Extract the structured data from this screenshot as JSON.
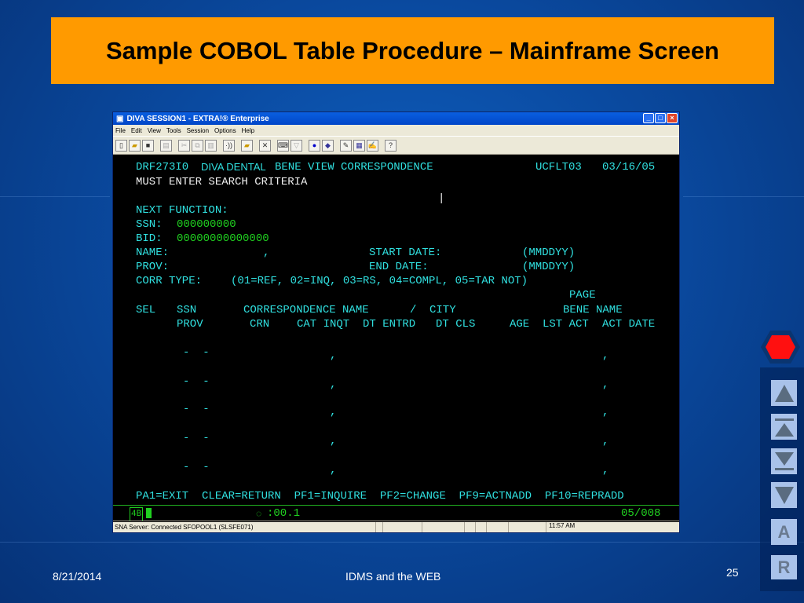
{
  "slide": {
    "title": "Sample COBOL Table Procedure – Mainframe Screen",
    "date": "8/21/2014",
    "footer": "IDMS and the WEB",
    "page": "25"
  },
  "window": {
    "title": "DIVA SESSION1 - EXTRA!® Enterprise",
    "menu": [
      "File",
      "Edit",
      "View",
      "Tools",
      "Session",
      "Options",
      "Help"
    ],
    "status": "SNA Server: Connected SFOPOOL1 (SLSFE071)",
    "clock": "11:57 AM"
  },
  "terminal": {
    "program": "DRF273I0",
    "system": "DIVA DENTAL",
    "screen_title": "BENE VIEW CORRESPONDENCE",
    "user": "UCFLT03",
    "date": "03/16/05",
    "message": "MUST ENTER SEARCH CRITERIA",
    "next_function_label": "NEXT FUNCTION:",
    "ssn_label": "SSN:",
    "ssn_value": "000000000",
    "bid_label": "BID:",
    "bid_value": "00000000000000",
    "name_label": "NAME:",
    "name_comma": ",",
    "start_date_label": "START DATE:",
    "start_fmt": "(MMDDYY)",
    "prov_label": "PROV:",
    "end_date_label": "END DATE:",
    "end_fmt": "(MMDDYY)",
    "corr_type_label": "CORR TYPE:",
    "corr_types": "(01=REF, 02=INQ, 03=RS, 04=COMPL, 05=TAR NOT)",
    "headers": {
      "page": "PAGE",
      "sel": "SEL",
      "ssn": "SSN",
      "corr_name": "CORRESPONDENCE NAME",
      "slash": "/",
      "city": "CITY",
      "bene_name": "BENE NAME",
      "prov": "PROV",
      "crn": "CRN",
      "cat_inqt": "CAT INQT",
      "dt_entrd": "DT ENTRD",
      "dt_cls": "DT CLS",
      "age": "AGE",
      "lst_act": "LST ACT",
      "act_date": "ACT DATE"
    },
    "rows": [
      {
        "ssn": "-  -",
        "c1": ",",
        "c2": ","
      },
      {
        "ssn": "-  -",
        "c1": ",",
        "c2": ","
      },
      {
        "ssn": "-  -",
        "c1": ",",
        "c2": ","
      },
      {
        "ssn": "-  -",
        "c1": ",",
        "c2": ","
      },
      {
        "ssn": "-  -",
        "c1": ",",
        "c2": ","
      }
    ],
    "pf_keys": "PA1=EXIT  CLEAR=RETURN  PF1=INQUIRE  PF2=CHANGE  PF9=ACTNADD  PF10=REPRADD",
    "oia_indicator": "4B",
    "oia_timer": ":00.1",
    "cursor_pos": "05/008"
  },
  "nav_buttons": [
    "A",
    "R"
  ]
}
